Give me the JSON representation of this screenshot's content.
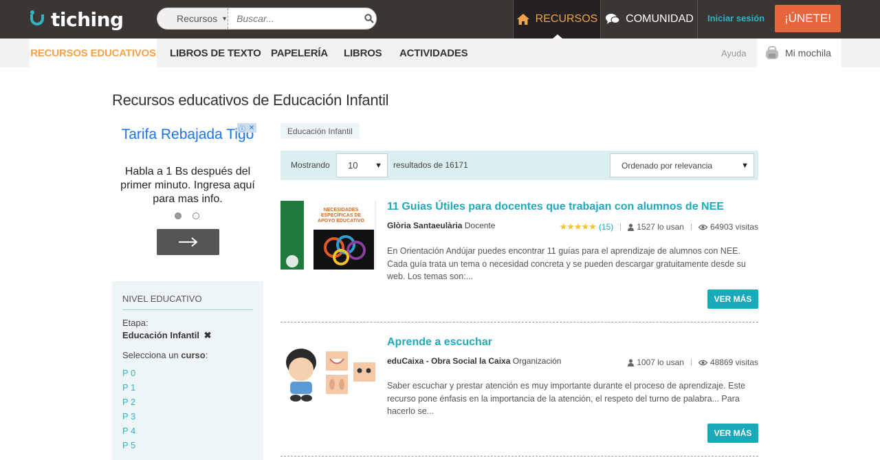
{
  "brand": {
    "name": "tiching",
    "accent": "#2fb5c4",
    "orange": "#f3a24a",
    "cta": "#e8643a"
  },
  "search": {
    "category": "Recursos",
    "placeholder": "Buscar..."
  },
  "topnav": {
    "recursos": "RECURSOS",
    "comunidad": "COMUNIDAD",
    "login": "Iniciar sesión",
    "join": "¡ÚNETE!"
  },
  "subnav": {
    "items": [
      "RECURSOS EDUCATIVOS",
      "LIBROS DE TEXTO",
      "PAPELERÍA",
      "LIBROS",
      "ACTIVIDADES"
    ],
    "help": "Ayuda",
    "backpack": "Mi mochila"
  },
  "page_title": "Recursos educativos de Educación Infantil",
  "ad": {
    "title": "Tarifa Rebajada Tigo",
    "body": "Habla a 1 Bs después del primer minuto. Ingresa aquí para mas info."
  },
  "filter": {
    "heading": "NIVEL EDUCATIVO",
    "stage_label": "Etapa:",
    "stage_value": "Educación Infantil",
    "course_prefix": "Selecciona un ",
    "course_word": "curso",
    "course_suffix": ":",
    "courses": [
      "P 0",
      "P 1",
      "P 2",
      "P 3",
      "P 4",
      "P 5"
    ]
  },
  "active_tag": "Educación Infantil",
  "results_bar": {
    "showing": "Mostrando",
    "per_page": "10",
    "results_text": "resultados de 16171",
    "sort": "Ordenado por relevancia"
  },
  "results": [
    {
      "title": "11 Guias Útiles para docentes que trabajan con alumnos de NEE",
      "author": "Glòria Santaeulària",
      "role": "Docente",
      "stars": "★★★★★",
      "rating_count": "(15)",
      "uses": "1527 lo usan",
      "views": "64903 visitas",
      "description": "En Orientación Andújar puedes encontrar 11 guías para el aprendizaje de alumnos con NEE. Cada guía trata un tema o necesidad concreta y se pueden descargar gratuitamente desde su web. Los temas son:...",
      "button": "VER MÁS",
      "thumb_text": "NECESIDADES ESPECÍFICAS DE APOYO EDUCATIVO"
    },
    {
      "title": "Aprende a escuchar",
      "author": "eduCaixa - Obra Social la Caixa",
      "role": "Organización",
      "uses": "1007 lo usan",
      "views": "48869 visitas",
      "description": "Saber escuchar y prestar atención es muy importante durante el proceso de aprendizaje. Este recurso pone énfasis en la importancia de la atención, el respeto del turno de palabra... Para hacerlo se...",
      "button": "VER MÁS"
    }
  ]
}
